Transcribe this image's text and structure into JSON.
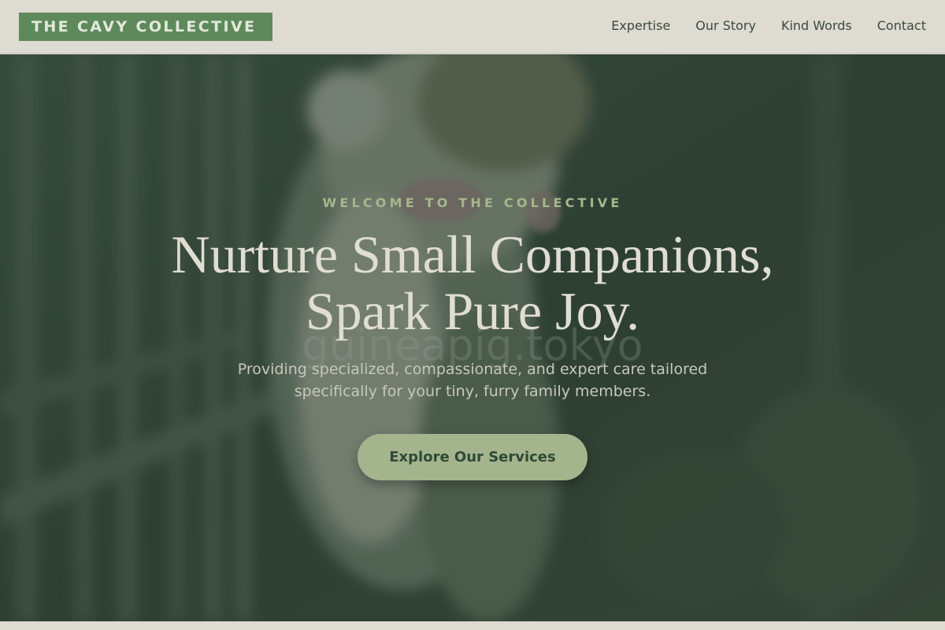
{
  "header": {
    "brand": "THE CAVY COLLECTIVE",
    "nav": [
      {
        "label": "Expertise"
      },
      {
        "label": "Our Story"
      },
      {
        "label": "Kind Words"
      },
      {
        "label": "Contact"
      }
    ]
  },
  "hero": {
    "eyebrow": "WELCOME TO THE COLLECTIVE",
    "headline_line1": "Nurture Small Companions,",
    "headline_line2": "Spark Pure Joy.",
    "subtext": "Providing specialized, compassionate, and expert care tailored specifically for your tiny, furry family members.",
    "cta_label": "Explore Our Services",
    "watermark": "guineapig.tokyo",
    "image_subject": "guinea-pig-photo"
  },
  "colors": {
    "brand_green": "#5e8a5b",
    "header_bg": "#dedbd2",
    "cta_bg": "#a4b48d",
    "cta_text": "#2e4a36",
    "eyebrow": "#a6b78d",
    "headline": "#e0ddd2"
  }
}
